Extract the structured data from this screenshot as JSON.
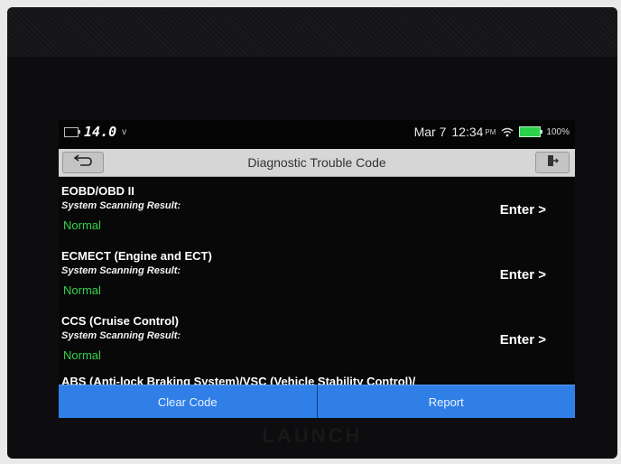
{
  "status_bar": {
    "voltage": "14.0",
    "voltage_unit": "v",
    "date": "Mar 7",
    "time": "12:34",
    "ampm": "PM",
    "battery": "100%",
    "icons": [
      "car-battery-icon",
      "wifi-icon",
      "battery-icon"
    ]
  },
  "title_bar": {
    "title": "Diagnostic Trouble Code",
    "back_icon": "back-arrow-icon",
    "exit_icon": "exit-icon"
  },
  "systems": [
    {
      "name": "EOBD/OBD II",
      "scan_label": "System Scanning Result:",
      "status": "Normal",
      "enter_label": "Enter >"
    },
    {
      "name": "ECMECT (Engine and ECT)",
      "scan_label": "System Scanning Result:",
      "status": "Normal",
      "enter_label": "Enter >"
    },
    {
      "name": "CCS (Cruise Control)",
      "scan_label": "System Scanning Result:",
      "status": "Normal",
      "enter_label": "Enter >"
    }
  ],
  "partial_item": "ABS (Anti-lock Braking System)/VSC (Vehicle Stability Control)/",
  "buttons": {
    "clear_code": "Clear Code",
    "report": "Report"
  },
  "device": {
    "brand": "LAUNCH"
  },
  "colors": {
    "accent": "#2f7fe6",
    "status_ok": "#37d14e",
    "title_bar": "#d6d6d6"
  }
}
